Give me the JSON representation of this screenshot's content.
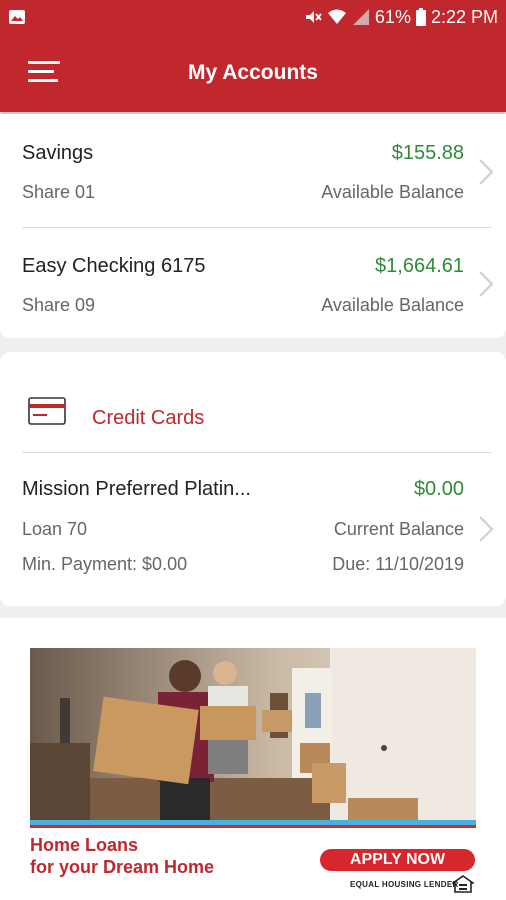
{
  "status_bar": {
    "battery": "61%",
    "time": "2:22 PM"
  },
  "app_bar": {
    "title": "My Accounts"
  },
  "accounts": [
    {
      "name": "Savings",
      "amount": "$155.88",
      "share": "Share 01",
      "label": "Available Balance"
    },
    {
      "name": "Easy Checking 6175",
      "amount": "$1,664.61",
      "share": "Share 09",
      "label": "Available Balance"
    }
  ],
  "credit_cards": {
    "title": "Credit Cards",
    "items": [
      {
        "name": "Mission Preferred Platin...",
        "amount": "$0.00",
        "loan": "Loan 70",
        "label": "Current Balance",
        "min_payment": "Min. Payment: $0.00",
        "due": "Due: 11/10/2019"
      }
    ]
  },
  "promo": {
    "line1": "Home Loans",
    "line2": "for your Dream Home",
    "cta": "APPLY NOW",
    "lender": "EQUAL HOUSING LENDER"
  },
  "colors": {
    "brand_red": "#c0282d",
    "positive_green": "#2e8b3a"
  }
}
